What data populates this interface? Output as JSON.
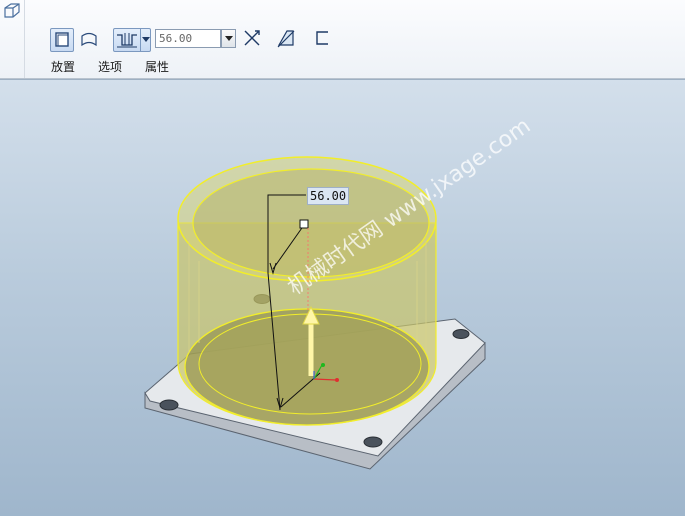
{
  "toolbar": {
    "depth_value": "56.00",
    "tabs": {
      "placement": "放置",
      "options": "选项",
      "properties": "属性"
    }
  },
  "viewport": {
    "dimension_label": "56.00",
    "watermark": "机械时代网 www.jxage.com"
  },
  "colors": {
    "accent": "#7b98bf",
    "preview_fill": "#c9c56a",
    "preview_edge": "#f2ee2a",
    "flange": "#d9dde2"
  }
}
